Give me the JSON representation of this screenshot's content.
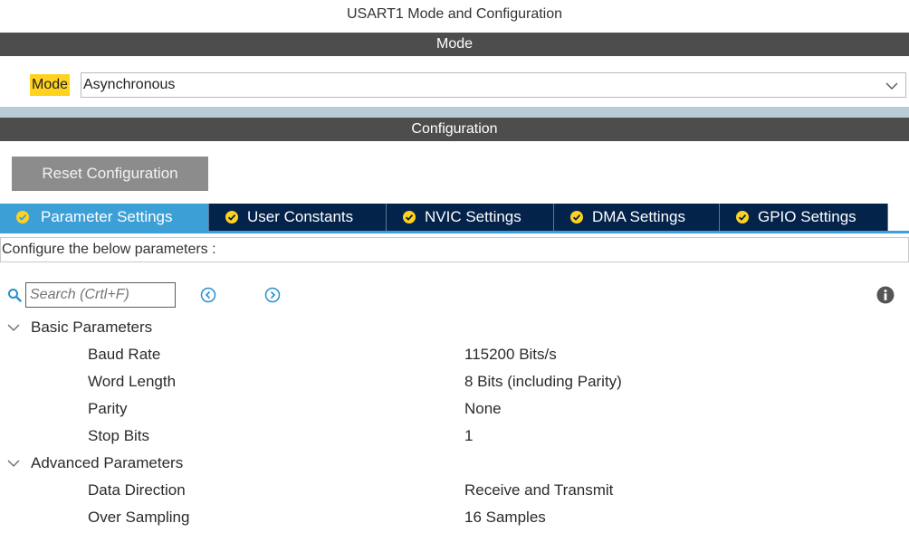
{
  "window": {
    "title": "USART1 Mode and Configuration"
  },
  "mode_section": {
    "header": "Mode",
    "label": "Mode",
    "selected_value": "Asynchronous",
    "dropdown_icon": "chevron-down-icon"
  },
  "config_section": {
    "header": "Configuration",
    "reset_button": "Reset Configuration"
  },
  "tabs": [
    {
      "label": "Parameter Settings",
      "active": true,
      "icon": "check-circle-icon"
    },
    {
      "label": "User Constants",
      "active": false,
      "icon": "check-circle-icon"
    },
    {
      "label": "NVIC Settings",
      "active": false,
      "icon": "check-circle-icon"
    },
    {
      "label": "DMA Settings",
      "active": false,
      "icon": "check-circle-icon"
    },
    {
      "label": "GPIO Settings",
      "active": false,
      "icon": "check-circle-icon"
    }
  ],
  "description": "Configure the below parameters :",
  "search": {
    "placeholder": "Search (Crtl+F)"
  },
  "parameters": {
    "groups": [
      {
        "label": "Basic Parameters",
        "items": [
          {
            "name": "Baud Rate",
            "value": "115200 Bits/s"
          },
          {
            "name": "Word Length",
            "value": "8 Bits (including Parity)"
          },
          {
            "name": "Parity",
            "value": "None"
          },
          {
            "name": "Stop Bits",
            "value": "1"
          }
        ]
      },
      {
        "label": "Advanced Parameters",
        "items": [
          {
            "name": "Data Direction",
            "value": "Receive and Transmit"
          },
          {
            "name": "Over Sampling",
            "value": "16 Samples"
          }
        ]
      }
    ]
  },
  "colors": {
    "section_bar": "#4d4d4d",
    "tab_active": "#3c9fd6",
    "tab_inactive": "#03234b",
    "highlight": "#ffd21f",
    "icon_blue": "#2a8fd0"
  }
}
